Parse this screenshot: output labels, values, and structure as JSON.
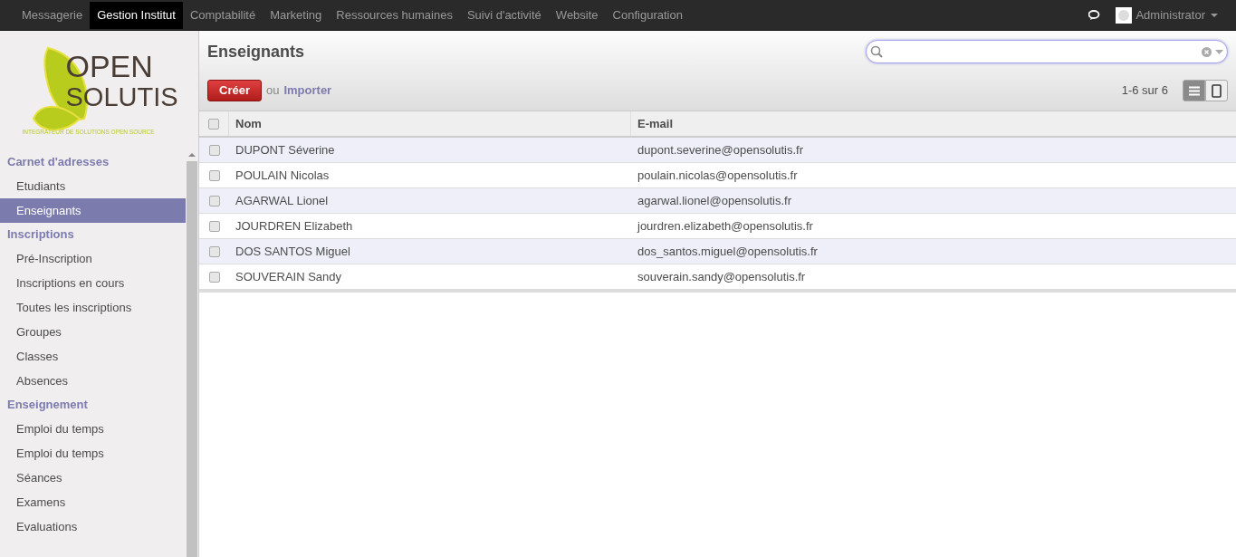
{
  "top_menu": [
    {
      "label": "Messagerie",
      "selected": false
    },
    {
      "label": "Gestion Institut",
      "selected": true
    },
    {
      "label": "Comptabilité",
      "selected": false
    },
    {
      "label": "Marketing",
      "selected": false
    },
    {
      "label": "Ressources humaines",
      "selected": false
    },
    {
      "label": "Suivi d'activité",
      "selected": false
    },
    {
      "label": "Website",
      "selected": false
    },
    {
      "label": "Configuration",
      "selected": false
    }
  ],
  "user": {
    "name": "Administrator"
  },
  "logo": {
    "line_1": "OPEN",
    "line_2": "SOLUTIS",
    "tagline": "INTEGRATEUR DE SOLUTIONS OPEN SOURCE"
  },
  "sidebar": [
    {
      "title": "Carnet d'adresses",
      "items": [
        {
          "label": "Etudiants",
          "selected": false
        },
        {
          "label": "Enseignants",
          "selected": true
        }
      ]
    },
    {
      "title": "Inscriptions",
      "items": [
        {
          "label": "Pré-Inscription",
          "selected": false
        },
        {
          "label": "Inscriptions en cours",
          "selected": false
        },
        {
          "label": "Toutes les inscriptions",
          "selected": false
        },
        {
          "label": "Groupes",
          "selected": false
        },
        {
          "label": "Classes",
          "selected": false
        },
        {
          "label": "Absences",
          "selected": false
        }
      ]
    },
    {
      "title": "Enseignement",
      "items": [
        {
          "label": "Emploi du temps",
          "selected": false
        },
        {
          "label": "Emploi du temps",
          "selected": false
        },
        {
          "label": "Séances",
          "selected": false
        },
        {
          "label": "Examens",
          "selected": false
        },
        {
          "label": "Evaluations",
          "selected": false
        }
      ]
    }
  ],
  "page": {
    "title": "Enseignants",
    "create": "Créer",
    "or": "ou",
    "import": "Importer",
    "pager": "1-6 sur 6"
  },
  "views": [
    {
      "kind": "list",
      "selected": true
    },
    {
      "kind": "form",
      "selected": false
    }
  ],
  "table": {
    "all_checked": false,
    "columns": [
      "Nom",
      "E-mail"
    ],
    "rows": [
      {
        "name": "DUPONT Séverine",
        "email": "dupont.severine@opensolutis.fr",
        "checked": false
      },
      {
        "name": "POULAIN Nicolas",
        "email": "poulain.nicolas@opensolutis.fr",
        "checked": false
      },
      {
        "name": "AGARWAL Lionel",
        "email": "agarwal.lionel@opensolutis.fr",
        "checked": false
      },
      {
        "name": "JOURDREN Elizabeth",
        "email": "jourdren.elizabeth@opensolutis.fr",
        "checked": false
      },
      {
        "name": "DOS SANTOS Miguel",
        "email": "dos_santos.miguel@opensolutis.fr",
        "checked": false
      },
      {
        "name": "SOUVERAIN Sandy",
        "email": "souverain.sandy@opensolutis.fr",
        "checked": false
      }
    ]
  }
}
